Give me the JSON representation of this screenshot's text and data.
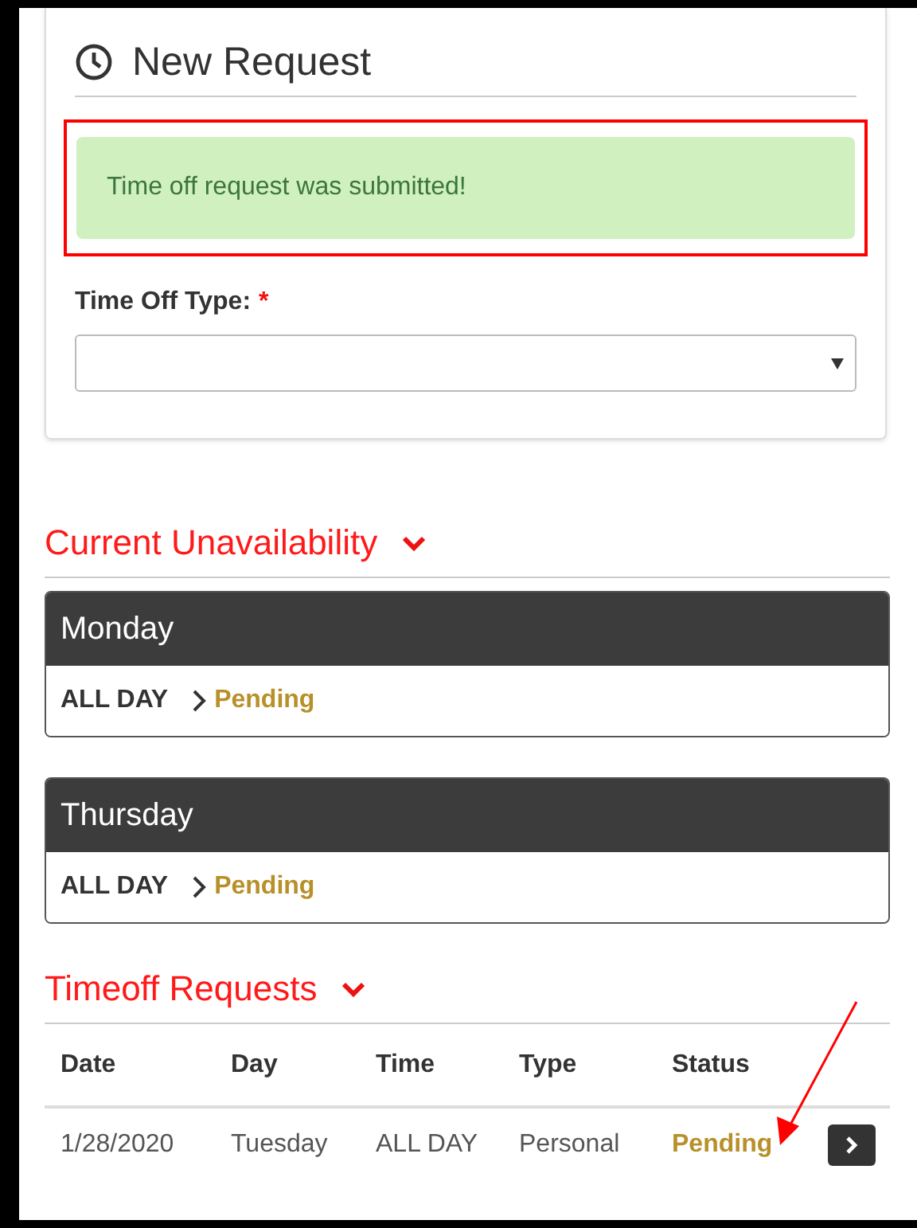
{
  "form": {
    "title": "New Request",
    "alert": "Time off request was submitted!",
    "field_label": "Time Off Type:",
    "required_mark": "*"
  },
  "unavailability": {
    "title": "Current Unavailability",
    "expanded": true,
    "days": [
      {
        "day": "Monday",
        "time": "ALL DAY",
        "status": "Pending"
      },
      {
        "day": "Thursday",
        "time": "ALL DAY",
        "status": "Pending"
      }
    ]
  },
  "requests": {
    "title": "Timeoff Requests",
    "expanded": true,
    "columns": [
      "Date",
      "Day",
      "Time",
      "Type",
      "Status"
    ],
    "rows": [
      {
        "cells": [
          "1/28/2020",
          "Tuesday",
          "ALL DAY",
          "Personal"
        ],
        "status": "Pending"
      }
    ]
  }
}
